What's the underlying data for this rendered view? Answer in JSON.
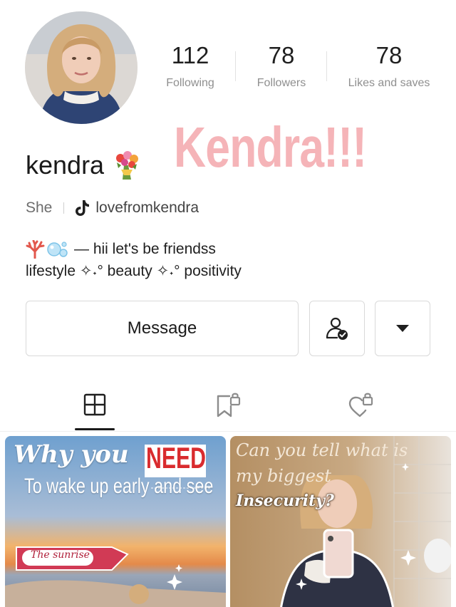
{
  "profile": {
    "username": "kendra",
    "username_emoji": "bouquet-icon",
    "banner_text": "Kendra!!!",
    "pronoun": "She",
    "tiktok_handle": "lovefromkendra",
    "bio_line1": "— hii let's be friendss",
    "bio_line2": "lifestyle ✧˖° beauty ✧˖° positivity"
  },
  "stats": [
    {
      "value": "112",
      "label": "Following"
    },
    {
      "value": "78",
      "label": "Followers"
    },
    {
      "value": "78",
      "label": "Likes and saves"
    }
  ],
  "actions": {
    "message_label": "Message",
    "follow_icon": "person-check-icon",
    "more_icon": "caret-down-icon"
  },
  "tabs": [
    {
      "icon": "grid-layout-icon",
      "selected": true
    },
    {
      "icon": "locked-bookmark-icon",
      "selected": false
    },
    {
      "icon": "locked-heart-icon",
      "selected": false
    }
  ],
  "posts": [
    {
      "line1": "Why you",
      "line1_highlight": "NEED",
      "line2": "To wake up early and see",
      "tag": "The sunrise"
    },
    {
      "line1": "Can you tell what is",
      "line2": "my biggest",
      "line3": "Insecurity?"
    }
  ],
  "colors": {
    "banner_pink": "#f5b4b8",
    "accent_red": "#d92b2e",
    "text_gray": "#8f8f8f"
  }
}
